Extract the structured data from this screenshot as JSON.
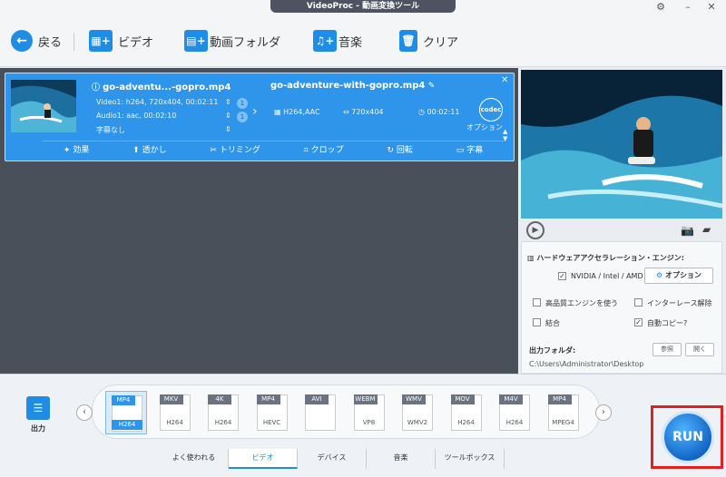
{
  "window": {
    "title": "VideoProc - 動画変換ツール"
  },
  "toolbar": {
    "back": "戻る",
    "video": "ビデオ",
    "folder": "動画フォルダ",
    "music": "音楽",
    "clear": "クリア"
  },
  "file": {
    "source_name": "go-adventu...-gopro.mp4",
    "video_info": "Video1: h264, 720x404, 00:02:11",
    "audio_info": "Audio1: aac, 00:02:10",
    "subtitle_info": "字幕なし",
    "output_name": "go-adventure-with-gopro.mp4",
    "out_codec": "H264,AAC",
    "out_res": "720x404",
    "out_duration": "00:02:11",
    "codec_badge": "codec",
    "option_label": "オプション",
    "video_track_num": "1",
    "audio_track_num": "1",
    "tools": [
      "効果",
      "透かし",
      "トリミング",
      "クロップ",
      "回転",
      "字幕"
    ]
  },
  "settings": {
    "hw_title": "ハードウェアアクセラレーション・エンジン:",
    "hw_label": "NVIDIA / Intel / AMD",
    "option_btn": "オプション",
    "hq_engine": "高品質エンジンを使う",
    "deinterlace": "インターレース解除",
    "merge": "結合",
    "auto_copy": "自動コピー?",
    "output_folder_label": "出力フォルダ:",
    "output_path": "C:\\Users\\Administrator\\Desktop",
    "browse": "参照",
    "open": "開く"
  },
  "output_button": {
    "label": "出力"
  },
  "formats": [
    {
      "top": "MP4",
      "bottom": "H264",
      "selected": true
    },
    {
      "top": "MKV",
      "bottom": "H264"
    },
    {
      "top": "4K",
      "bottom": "H264"
    },
    {
      "top": "MP4",
      "bottom": "HEVC"
    },
    {
      "top": "AVI",
      "bottom": ""
    },
    {
      "top": "WEBM",
      "bottom": "VP8"
    },
    {
      "top": "WMV",
      "bottom": "WMV2"
    },
    {
      "top": "MOV",
      "bottom": "H264"
    },
    {
      "top": "M4V",
      "bottom": "H264"
    },
    {
      "top": "MP4",
      "bottom": "MPEG4"
    }
  ],
  "tabs": [
    "よく使われる",
    "ビデオ",
    "デバイス",
    "音楽",
    "ツールボックス"
  ],
  "run": {
    "label": "RUN"
  }
}
